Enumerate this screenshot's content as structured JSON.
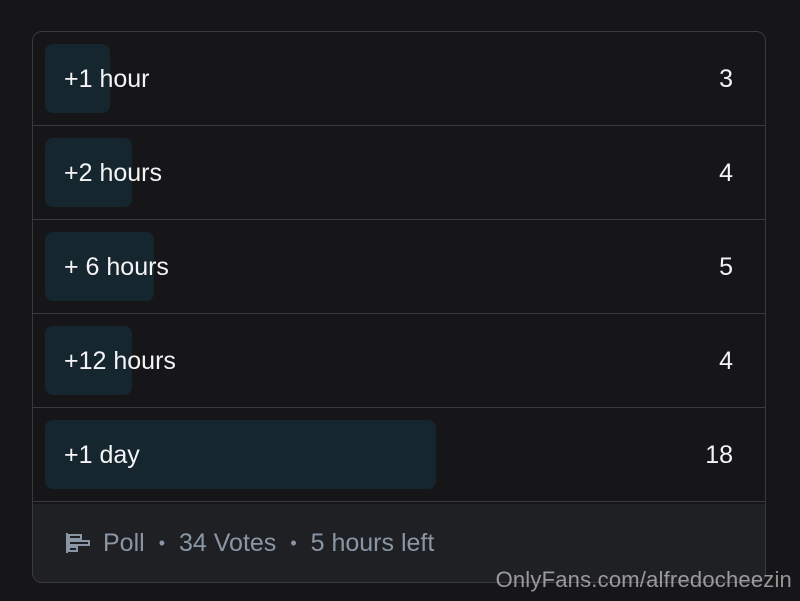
{
  "poll": {
    "options": [
      {
        "label": "+1 hour",
        "count": "3",
        "share": 0.088
      },
      {
        "label": "+2 hours",
        "count": "4",
        "share": 0.118
      },
      {
        "label": "+ 6 hours",
        "count": "5",
        "share": 0.147
      },
      {
        "label": "+12 hours",
        "count": "4",
        "share": 0.118
      },
      {
        "label": "+1 day",
        "count": "18",
        "share": 0.529
      }
    ],
    "footer": {
      "icon": "poll-bars-icon",
      "type_label": "Poll",
      "votes_label": "34 Votes",
      "time_left_label": "5 hours left",
      "separator": "•"
    }
  },
  "watermark": "OnlyFans.com/alfredocheezin",
  "colors": {
    "background": "#161618",
    "option_fill": "#16262f",
    "border": "#3a3b3f",
    "footer_bg": "#1f2024",
    "muted_text": "#8a96a3",
    "text": "#f4f4f6"
  }
}
